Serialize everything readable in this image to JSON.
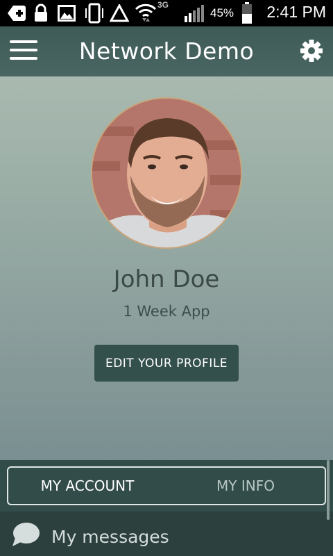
{
  "status_bar": {
    "time": "2:41 PM",
    "battery_percent": "45%",
    "network_label": "3G",
    "icons": [
      "add-box-icon",
      "lock-icon",
      "image-icon",
      "vibrate-icon",
      "alert-triangle-icon",
      "wifi-icon",
      "signal-icon",
      "battery-icon"
    ]
  },
  "header": {
    "title": "Network Demo",
    "menu_icon": "hamburger-icon",
    "settings_icon": "gear-icon"
  },
  "profile": {
    "name": "John Doe",
    "subtitle": "1 Week App",
    "edit_label": "EDIT YOUR PROFILE"
  },
  "tabs": [
    {
      "label": "MY ACCOUNT",
      "active": true
    },
    {
      "label": "MY INFO",
      "active": false
    }
  ],
  "list": {
    "items": [
      {
        "label": "My messages",
        "icon": "chat-bubble-icon"
      }
    ]
  },
  "colors": {
    "header": "#3e5b58",
    "button": "#34504c",
    "tabbar": "#324c49"
  }
}
